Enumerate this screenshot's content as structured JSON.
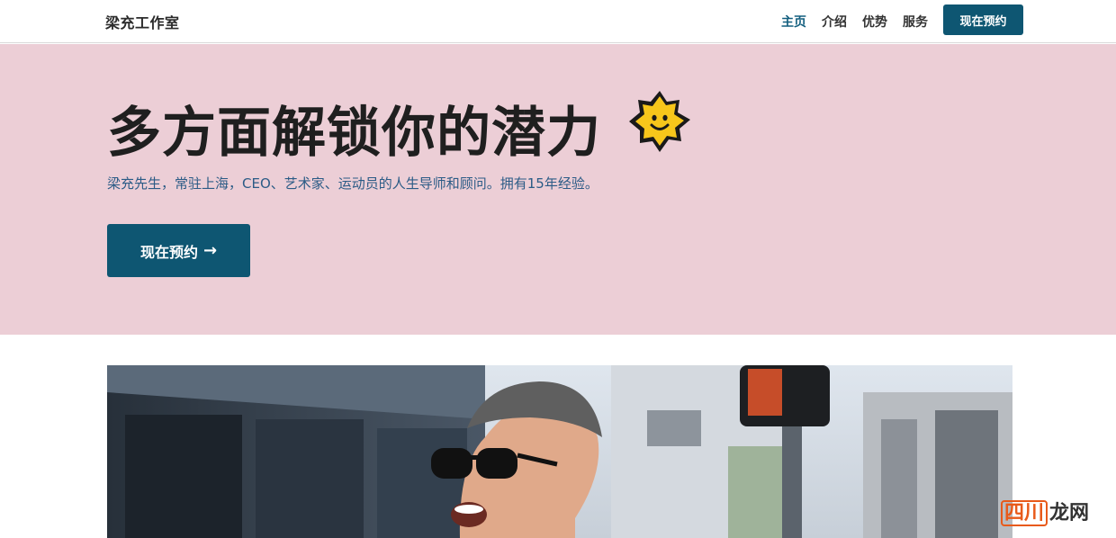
{
  "nav": {
    "brand": "梁充工作室",
    "links": [
      "主页",
      "介绍",
      "优势",
      "服务"
    ],
    "active_index": 0,
    "cta": "现在预约"
  },
  "hero": {
    "title": "多方面解锁你的潜力",
    "subtitle": "梁充先生，常驻上海，CEO、艺术家、运动员的人生导师和顾问。拥有15年经验。",
    "button_label": "现在预约",
    "button_arrow": "→",
    "emoji_icon": "sun-smile-icon",
    "background_color": "#ecced6",
    "accent_color": "#0e5672"
  },
  "photo": {
    "description_icon": "hero-photo"
  },
  "watermark": {
    "part1": "四川",
    "part2": "龙网"
  }
}
